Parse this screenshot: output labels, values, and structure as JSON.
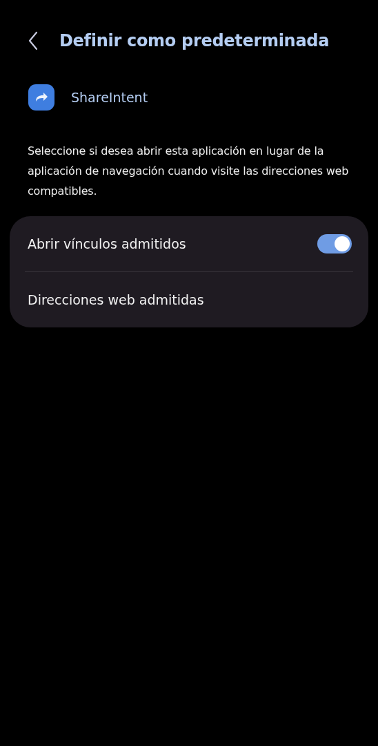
{
  "header": {
    "title": "Definir como predeterminada"
  },
  "app": {
    "name": "ShareIntent"
  },
  "description": "Seleccione si desea abrir esta aplicación en lugar de la aplicación de navegación cuando visite las direcciones web compatibles.",
  "settings": [
    {
      "kind": "toggle",
      "label": "Abrir vínculos admitidos",
      "on": true
    },
    {
      "kind": "link",
      "label": "Direcciones web admitidas"
    }
  ]
}
